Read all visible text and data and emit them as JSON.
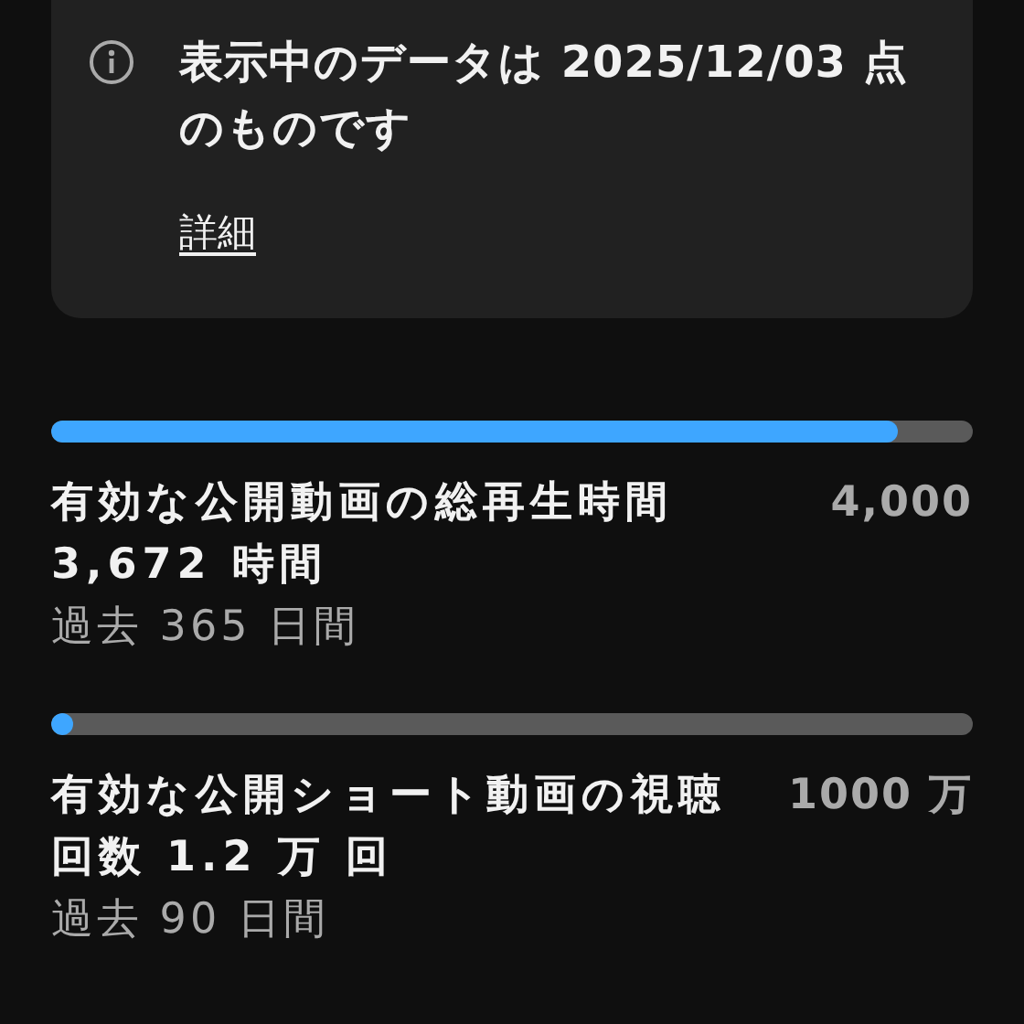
{
  "notice": {
    "text": "表示中のデータは 2025/12/03 点のものです",
    "link": "詳細"
  },
  "metrics": [
    {
      "label": "有効な公開動画の総再生時間 3,672 時間",
      "goal": "4,000",
      "period": "過去 365 日間",
      "level": 0.918
    },
    {
      "label": "有効な公開ショート動画の視聴回数 1.2 万 回",
      "goal": "1000 万",
      "period": "過去 90 日間",
      "level": 0.0012
    }
  ]
}
